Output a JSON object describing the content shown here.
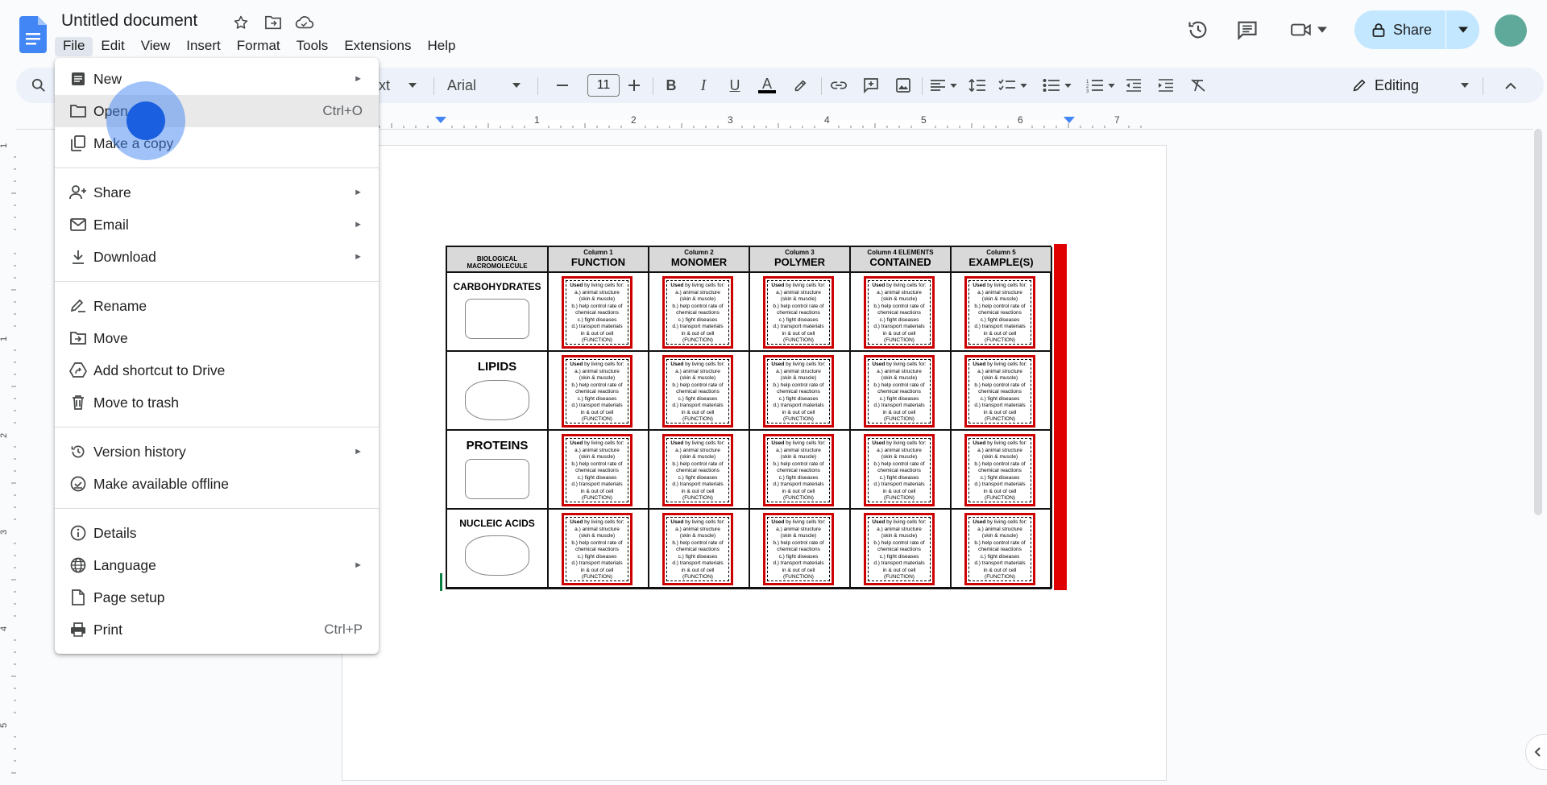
{
  "document": {
    "title": "Untitled document"
  },
  "menubar": [
    "File",
    "Edit",
    "View",
    "Insert",
    "Format",
    "Tools",
    "Extensions",
    "Help"
  ],
  "header": {
    "share_label": "Share"
  },
  "toolbar": {
    "style_label": "ext",
    "font_name": "Arial",
    "font_size": "11",
    "editing_mode": "Editing"
  },
  "ruler": {
    "numbers": [
      "1",
      "2",
      "3",
      "4",
      "5",
      "6",
      "7"
    ],
    "vertical_numbers": [
      "1",
      "1",
      "2",
      "3",
      "4",
      "5"
    ]
  },
  "file_menu": {
    "items": [
      {
        "label": "New",
        "icon": "new-doc-icon",
        "submenu": true
      },
      {
        "label": "Open",
        "icon": "folder-icon",
        "shortcut": "Ctrl+O"
      },
      {
        "label": "Make a copy",
        "icon": "copy-icon"
      },
      {
        "label": "Share",
        "icon": "person-add-icon",
        "submenu": true
      },
      {
        "label": "Email",
        "icon": "mail-icon",
        "submenu": true
      },
      {
        "label": "Download",
        "icon": "download-icon",
        "submenu": true
      },
      {
        "label": "Rename",
        "icon": "rename-icon"
      },
      {
        "label": "Move",
        "icon": "move-icon"
      },
      {
        "label": "Add shortcut to Drive",
        "icon": "drive-shortcut-icon"
      },
      {
        "label": "Move to trash",
        "icon": "trash-icon"
      },
      {
        "label": "Version history",
        "icon": "history-icon",
        "submenu": true
      },
      {
        "label": "Make available offline",
        "icon": "offline-icon"
      },
      {
        "label": "Details",
        "icon": "info-icon"
      },
      {
        "label": "Language",
        "icon": "globe-icon",
        "submenu": true
      },
      {
        "label": "Page setup",
        "icon": "page-setup-icon"
      },
      {
        "label": "Print",
        "icon": "print-icon",
        "shortcut": "Ctrl+P"
      }
    ]
  },
  "table": {
    "corner_header": "BIOLOGICAL MACROMOLECULE",
    "columns": [
      {
        "small": "Column 1",
        "big": "FUNCTION"
      },
      {
        "small": "Column 2",
        "big": "MONOMER"
      },
      {
        "small": "Column 3",
        "big": "POLYMER"
      },
      {
        "small": "Column 4 ELEMENTS",
        "big": "CONTAINED"
      },
      {
        "small": "Column 5",
        "big": "EXAMPLE(S)"
      }
    ],
    "rows": [
      "CARBOHYDRATES",
      "LIPIDS",
      "PROTEINS",
      "NUCLEIC ACIDS"
    ],
    "card": {
      "line1_bold": "Used",
      "line1": " by living cells for:",
      "a": "a.) animal structure (skin & muscle)",
      "b": "b.) help control rate of chemical reactions",
      "c": "c.) fight diseases",
      "d": "d.) transport materials in & out of cell",
      "footer": "(FUNCTION)",
      "num": "1"
    }
  }
}
